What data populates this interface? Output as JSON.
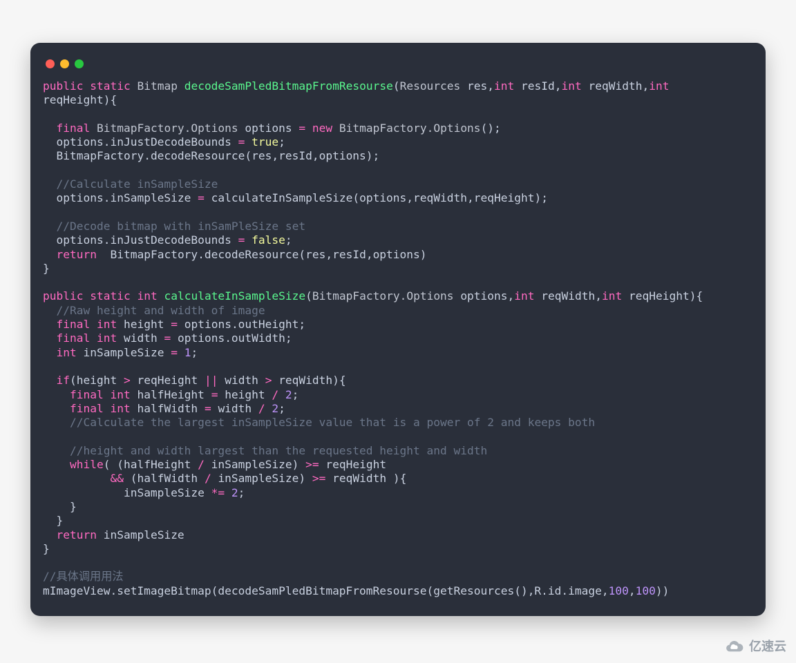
{
  "title": "code screenshot",
  "watermark": "亿速云",
  "code": {
    "tokens": [
      [
        [
          "kw",
          "public"
        ],
        [
          "sp",
          " "
        ],
        [
          "kw",
          "static"
        ],
        [
          "sp",
          " "
        ],
        [
          "ty",
          "Bitmap"
        ],
        [
          "sp",
          " "
        ],
        [
          "fn",
          "decodeSamPledBitmapFromResourse"
        ],
        [
          "id",
          "("
        ],
        [
          "ty",
          "Resources"
        ],
        [
          "sp",
          " "
        ],
        [
          "id",
          "res"
        ],
        [
          "id",
          ","
        ],
        [
          "kw",
          "int"
        ],
        [
          "sp",
          " "
        ],
        [
          "id",
          "resId"
        ],
        [
          "id",
          ","
        ],
        [
          "kw",
          "int"
        ],
        [
          "sp",
          " "
        ],
        [
          "id",
          "reqWidth"
        ],
        [
          "id",
          ","
        ],
        [
          "kw",
          "int"
        ]
      ],
      [
        [
          "id",
          "reqHeight){"
        ]
      ],
      [],
      [
        [
          "sp",
          "  "
        ],
        [
          "kw",
          "final"
        ],
        [
          "sp",
          " "
        ],
        [
          "ty",
          "BitmapFactory.Options"
        ],
        [
          "sp",
          " "
        ],
        [
          "id",
          "options"
        ],
        [
          "sp",
          " "
        ],
        [
          "op",
          "="
        ],
        [
          "sp",
          " "
        ],
        [
          "kw",
          "new"
        ],
        [
          "sp",
          " "
        ],
        [
          "ty",
          "BitmapFactory.Options"
        ],
        [
          "id",
          "();"
        ]
      ],
      [
        [
          "sp",
          "  "
        ],
        [
          "id",
          "options.inJustDecodeBounds"
        ],
        [
          "sp",
          " "
        ],
        [
          "op",
          "="
        ],
        [
          "sp",
          " "
        ],
        [
          "lit",
          "true"
        ],
        [
          "id",
          ";"
        ]
      ],
      [
        [
          "sp",
          "  "
        ],
        [
          "id",
          "BitmapFactory.decodeResource(res,resId,options);"
        ]
      ],
      [],
      [
        [
          "sp",
          "  "
        ],
        [
          "cm",
          "//Calculate inSampleSize"
        ]
      ],
      [
        [
          "sp",
          "  "
        ],
        [
          "id",
          "options.inSampleSize"
        ],
        [
          "sp",
          " "
        ],
        [
          "op",
          "="
        ],
        [
          "sp",
          " "
        ],
        [
          "id",
          "calculateInSampleSize(options,reqWidth,reqHeight);"
        ]
      ],
      [],
      [
        [
          "sp",
          "  "
        ],
        [
          "cm",
          "//Decode bitmap with inSamPleSize set"
        ]
      ],
      [
        [
          "sp",
          "  "
        ],
        [
          "id",
          "options.inJustDecodeBounds"
        ],
        [
          "sp",
          " "
        ],
        [
          "op",
          "="
        ],
        [
          "sp",
          " "
        ],
        [
          "lit",
          "false"
        ],
        [
          "id",
          ";"
        ]
      ],
      [
        [
          "sp",
          "  "
        ],
        [
          "kw",
          "return"
        ],
        [
          "sp",
          "  "
        ],
        [
          "id",
          "BitmapFactory.decodeResource(res,resId,options)"
        ]
      ],
      [
        [
          "id",
          "}"
        ]
      ],
      [],
      [
        [
          "kw",
          "public"
        ],
        [
          "sp",
          " "
        ],
        [
          "kw",
          "static"
        ],
        [
          "sp",
          " "
        ],
        [
          "kw",
          "int"
        ],
        [
          "sp",
          " "
        ],
        [
          "fn",
          "calculateInSampleSize"
        ],
        [
          "id",
          "("
        ],
        [
          "ty",
          "BitmapFactory.Options"
        ],
        [
          "sp",
          " "
        ],
        [
          "id",
          "options"
        ],
        [
          "id",
          ","
        ],
        [
          "kw",
          "int"
        ],
        [
          "sp",
          " "
        ],
        [
          "id",
          "reqWidth"
        ],
        [
          "id",
          ","
        ],
        [
          "kw",
          "int"
        ],
        [
          "sp",
          " "
        ],
        [
          "id",
          "reqHeight){"
        ]
      ],
      [
        [
          "sp",
          "  "
        ],
        [
          "cm",
          "//Raw height and width of image"
        ]
      ],
      [
        [
          "sp",
          "  "
        ],
        [
          "kw",
          "final"
        ],
        [
          "sp",
          " "
        ],
        [
          "kw",
          "int"
        ],
        [
          "sp",
          " "
        ],
        [
          "id",
          "height"
        ],
        [
          "sp",
          " "
        ],
        [
          "op",
          "="
        ],
        [
          "sp",
          " "
        ],
        [
          "id",
          "options.outHeight;"
        ]
      ],
      [
        [
          "sp",
          "  "
        ],
        [
          "kw",
          "final"
        ],
        [
          "sp",
          " "
        ],
        [
          "kw",
          "int"
        ],
        [
          "sp",
          " "
        ],
        [
          "id",
          "width"
        ],
        [
          "sp",
          " "
        ],
        [
          "op",
          "="
        ],
        [
          "sp",
          " "
        ],
        [
          "id",
          "options.outWidth;"
        ]
      ],
      [
        [
          "sp",
          "  "
        ],
        [
          "kw",
          "int"
        ],
        [
          "sp",
          " "
        ],
        [
          "id",
          "inSampleSize"
        ],
        [
          "sp",
          " "
        ],
        [
          "op",
          "="
        ],
        [
          "sp",
          " "
        ],
        [
          "num",
          "1"
        ],
        [
          "id",
          ";"
        ]
      ],
      [],
      [
        [
          "sp",
          "  "
        ],
        [
          "kw",
          "if"
        ],
        [
          "id",
          "(height"
        ],
        [
          "sp",
          " "
        ],
        [
          "op",
          ">"
        ],
        [
          "sp",
          " "
        ],
        [
          "id",
          "reqHeight"
        ],
        [
          "sp",
          " "
        ],
        [
          "op",
          "||"
        ],
        [
          "sp",
          " "
        ],
        [
          "id",
          "width"
        ],
        [
          "sp",
          " "
        ],
        [
          "op",
          ">"
        ],
        [
          "sp",
          " "
        ],
        [
          "id",
          "reqWidth){"
        ]
      ],
      [
        [
          "sp",
          "    "
        ],
        [
          "kw",
          "final"
        ],
        [
          "sp",
          " "
        ],
        [
          "kw",
          "int"
        ],
        [
          "sp",
          " "
        ],
        [
          "id",
          "halfHeight"
        ],
        [
          "sp",
          " "
        ],
        [
          "op",
          "="
        ],
        [
          "sp",
          " "
        ],
        [
          "id",
          "height"
        ],
        [
          "sp",
          " "
        ],
        [
          "op",
          "/"
        ],
        [
          "sp",
          " "
        ],
        [
          "num",
          "2"
        ],
        [
          "id",
          ";"
        ]
      ],
      [
        [
          "sp",
          "    "
        ],
        [
          "kw",
          "final"
        ],
        [
          "sp",
          " "
        ],
        [
          "kw",
          "int"
        ],
        [
          "sp",
          " "
        ],
        [
          "id",
          "halfWidth"
        ],
        [
          "sp",
          " "
        ],
        [
          "op",
          "="
        ],
        [
          "sp",
          " "
        ],
        [
          "id",
          "width"
        ],
        [
          "sp",
          " "
        ],
        [
          "op",
          "/"
        ],
        [
          "sp",
          " "
        ],
        [
          "num",
          "2"
        ],
        [
          "id",
          ";"
        ]
      ],
      [
        [
          "sp",
          "    "
        ],
        [
          "cm",
          "//Calculate the largest inSampleSize value that is a power of 2 and keeps both"
        ]
      ],
      [],
      [
        [
          "sp",
          "    "
        ],
        [
          "cm",
          "//height and width largest than the requested height and width"
        ]
      ],
      [
        [
          "sp",
          "    "
        ],
        [
          "kw",
          "while"
        ],
        [
          "id",
          "( (halfHeight"
        ],
        [
          "sp",
          " "
        ],
        [
          "op",
          "/"
        ],
        [
          "sp",
          " "
        ],
        [
          "id",
          "inSampleSize)"
        ],
        [
          "sp",
          " "
        ],
        [
          "op",
          ">="
        ],
        [
          "sp",
          " "
        ],
        [
          "id",
          "reqHeight"
        ]
      ],
      [
        [
          "sp",
          "          "
        ],
        [
          "op",
          "&&"
        ],
        [
          "sp",
          " "
        ],
        [
          "id",
          "(halfWidth"
        ],
        [
          "sp",
          " "
        ],
        [
          "op",
          "/"
        ],
        [
          "sp",
          " "
        ],
        [
          "id",
          "inSampleSize)"
        ],
        [
          "sp",
          " "
        ],
        [
          "op",
          ">="
        ],
        [
          "sp",
          " "
        ],
        [
          "id",
          "reqWidth ){"
        ]
      ],
      [
        [
          "sp",
          "            "
        ],
        [
          "id",
          "inSampleSize"
        ],
        [
          "sp",
          " "
        ],
        [
          "op",
          "*="
        ],
        [
          "sp",
          " "
        ],
        [
          "num",
          "2"
        ],
        [
          "id",
          ";"
        ]
      ],
      [
        [
          "sp",
          "    "
        ],
        [
          "id",
          "}"
        ]
      ],
      [
        [
          "sp",
          "  "
        ],
        [
          "id",
          "}"
        ]
      ],
      [
        [
          "sp",
          "  "
        ],
        [
          "kw",
          "return"
        ],
        [
          "sp",
          " "
        ],
        [
          "id",
          "inSampleSize"
        ]
      ],
      [
        [
          "id",
          "}"
        ]
      ],
      [],
      [
        [
          "cm",
          "//具体调用用法"
        ]
      ],
      [
        [
          "id",
          "mImageView.setImageBitmap(decodeSamPledBitmapFromResourse(getResources(),R.id.image,"
        ],
        [
          "num",
          "100"
        ],
        [
          "id",
          ","
        ],
        [
          "num",
          "100"
        ],
        [
          "id",
          "))"
        ]
      ]
    ]
  }
}
